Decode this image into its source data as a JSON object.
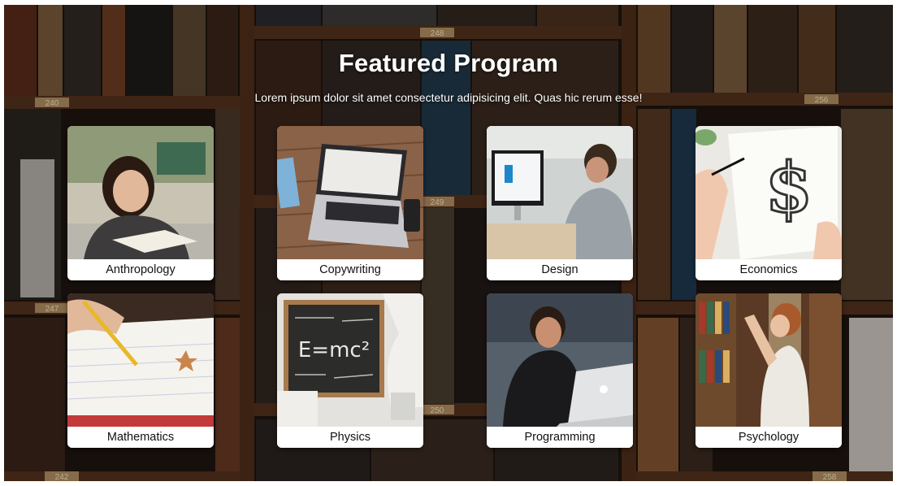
{
  "header": {
    "title": "Featured Program",
    "subtitle": "Lorem ipsum dolor sit amet consectetur adipisicing elit. Quas hic rerum esse!"
  },
  "shelf_labels": [
    "240",
    "248",
    "256",
    "249",
    "247",
    "250",
    "242",
    "258"
  ],
  "programs": [
    {
      "label": "Anthropology",
      "image": "student-reading-book-photo"
    },
    {
      "label": "Copywriting",
      "image": "laptop-on-wooden-desk-photo"
    },
    {
      "label": "Design",
      "image": "designer-at-desktop-photo"
    },
    {
      "label": "Economics",
      "image": "dollar-sign-drawing-photo"
    },
    {
      "label": "Mathematics",
      "image": "pencil-on-notebook-photo"
    },
    {
      "label": "Physics",
      "image": "chalkboard-emc2-photo"
    },
    {
      "label": "Programming",
      "image": "man-with-laptop-photo"
    },
    {
      "label": "Psychology",
      "image": "woman-in-library-photo"
    }
  ]
}
